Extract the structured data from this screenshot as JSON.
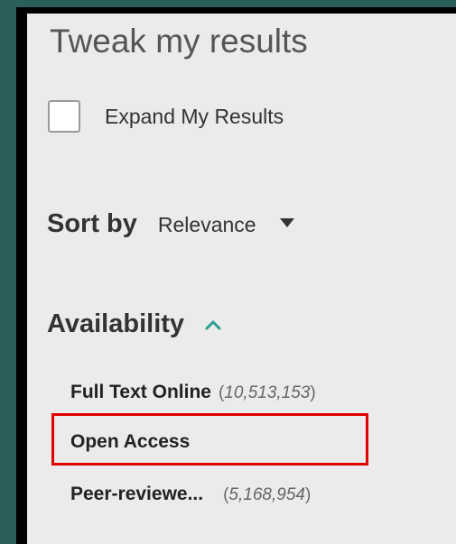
{
  "panel": {
    "title": "Tweak my results",
    "expand": {
      "label": "Expand My Results",
      "checked": false
    },
    "sort": {
      "label": "Sort by",
      "value": "Relevance"
    },
    "availability": {
      "label": "Availability",
      "facets": [
        {
          "label": "Full Text Online",
          "count": "10,513,153"
        },
        {
          "label": "Open Access",
          "count": ""
        },
        {
          "label": "Peer-reviewe...",
          "count": "5,168,954"
        }
      ]
    }
  },
  "colors": {
    "highlight": "#e00000",
    "chevron": "#2a9d8f"
  }
}
